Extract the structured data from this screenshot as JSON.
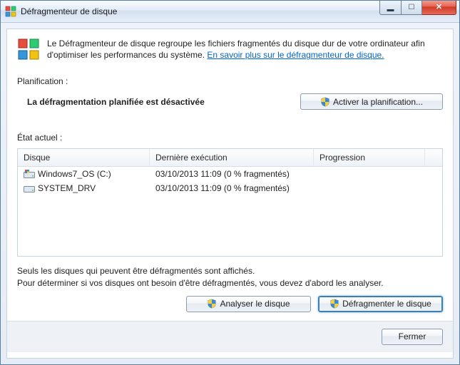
{
  "window": {
    "title": "Défragmenteur de disque"
  },
  "intro": {
    "text_before_link": "Le Défragmenteur de disque regroupe les fichiers fragmentés du disque dur de votre ordinateur afin d'optimiser les performances du système. ",
    "link_text": "En savoir plus sur le défragmenteur de disque."
  },
  "schedule": {
    "section_label": "Planification :",
    "status_text": "La défragmentation planifiée est désactivée",
    "activate_button": "Activer la planification..."
  },
  "current": {
    "section_label": "État actuel :"
  },
  "table": {
    "headers": {
      "disk": "Disque",
      "last_run": "Dernière exécution",
      "progress": "Progression"
    },
    "rows": [
      {
        "icon": "win-drive",
        "name": "Windows7_OS (C:)",
        "last_run": "03/10/2013 11:09 (0 % fragmentés)",
        "progress": ""
      },
      {
        "icon": "drive",
        "name": "SYSTEM_DRV",
        "last_run": "03/10/2013 11:09 (0 % fragmentés)",
        "progress": ""
      }
    ]
  },
  "hints": {
    "line1": "Seuls les disques qui peuvent être défragmentés sont affichés.",
    "line2": "Pour déterminer si vos disques ont besoin d'être défragmentés, vous devez d'abord les analyser."
  },
  "actions": {
    "analyze": "Analyser le disque",
    "defragment": "Défragmenter le disque"
  },
  "footer": {
    "close": "Fermer"
  }
}
